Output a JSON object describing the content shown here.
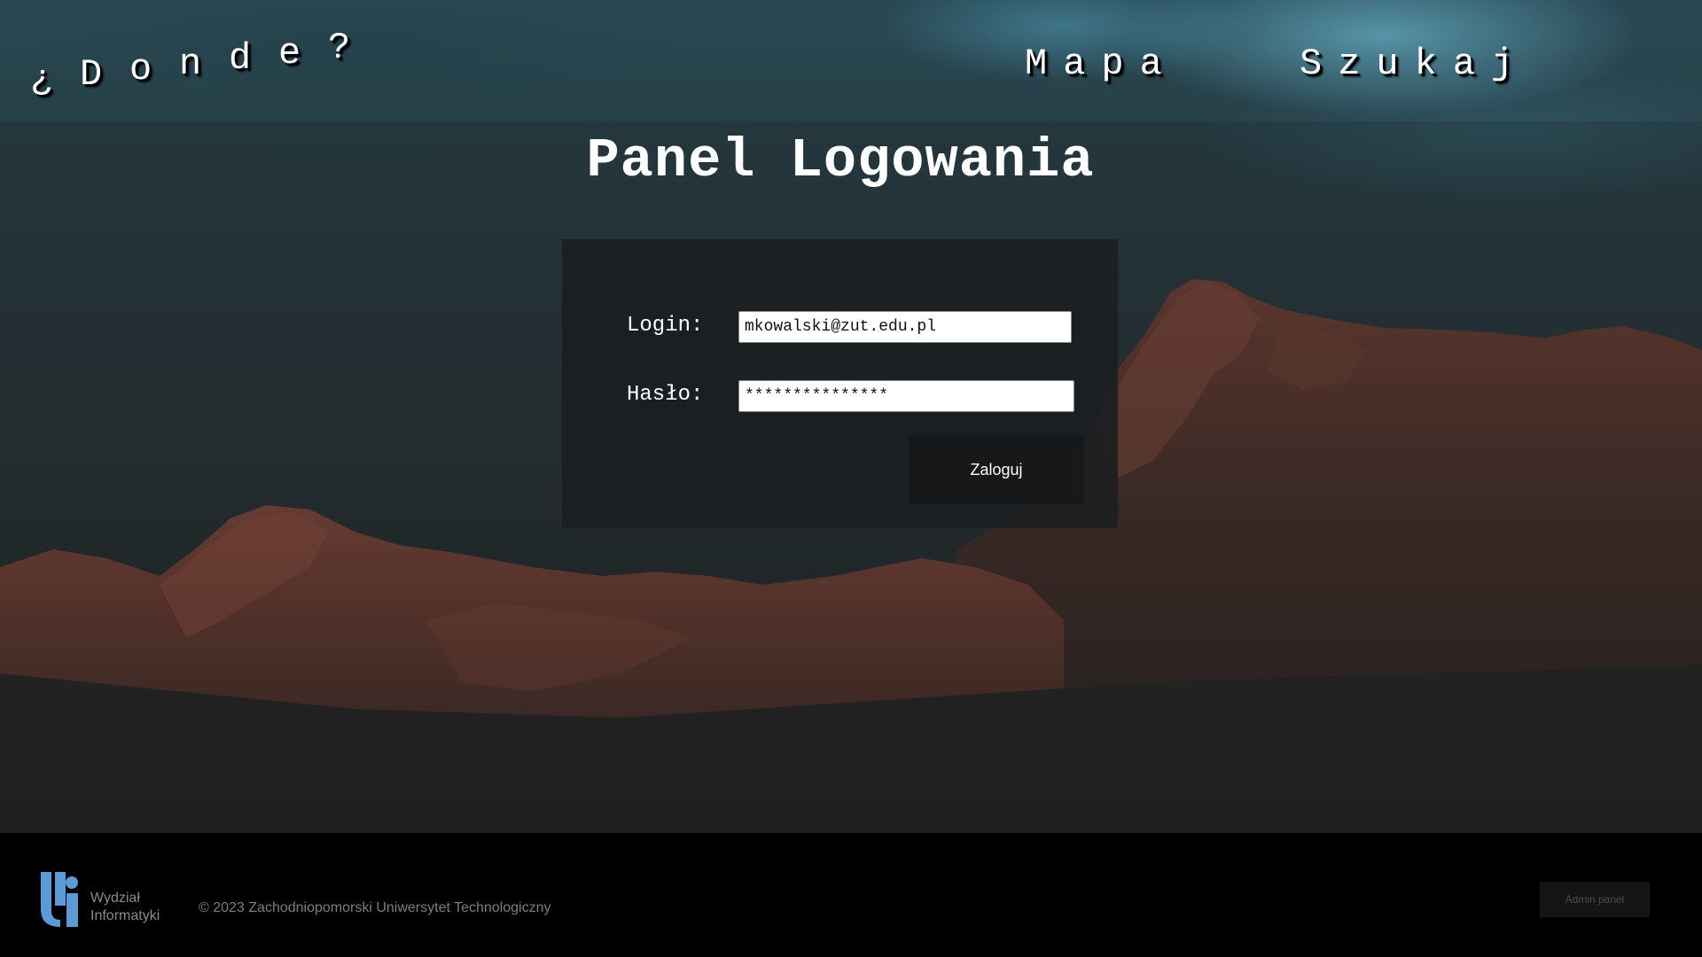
{
  "header": {
    "site_title": "¿Donde?",
    "nav": {
      "mapa": "Mapa",
      "szukaj": "Szukaj"
    }
  },
  "main": {
    "title": "Panel Logowania",
    "form": {
      "login_label": "Login:",
      "login_value": "mkowalski@zut.edu.pl",
      "password_label": "Hasło:",
      "password_value": "***************",
      "submit_label": "Zaloguj"
    }
  },
  "footer": {
    "logo_line1": "Wydział",
    "logo_line2": "Informatyki",
    "copyright": "© 2023 Zachodniopomorski Uniwersytet Technologiczny",
    "admin_label": "Admin panel"
  },
  "colors": {
    "footer_background": "#000000",
    "panel_background": "#1b1e20",
    "logo_blue": "#5b9bd5"
  },
  "icons": {
    "faculty_logo": "wi-faculty-logo-icon"
  }
}
